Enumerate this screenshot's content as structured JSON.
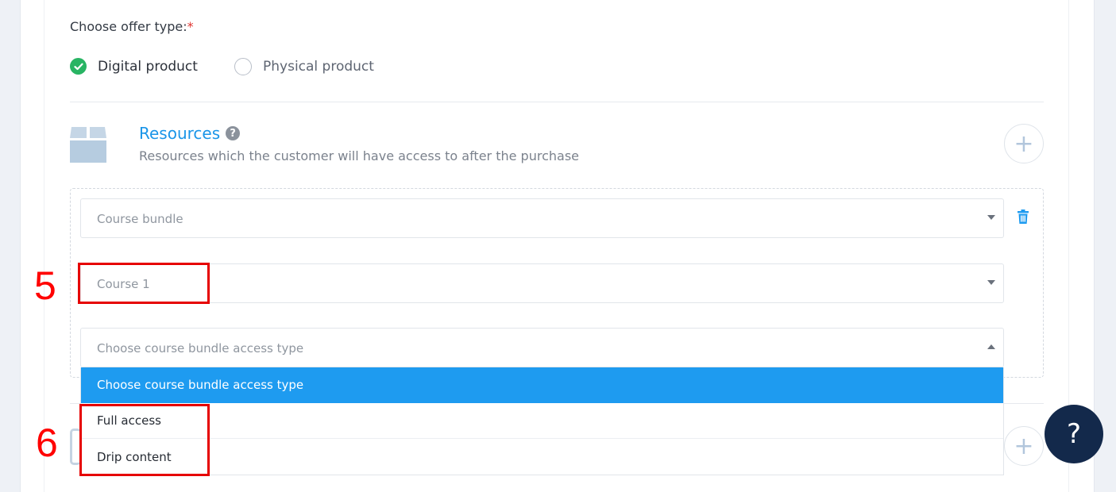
{
  "offer_type": {
    "label": "Choose offer type:",
    "required_mark": "*",
    "options": [
      {
        "label": "Digital product",
        "selected": true
      },
      {
        "label": "Physical product",
        "selected": false
      }
    ]
  },
  "resources": {
    "title": "Resources",
    "subtitle": "Resources which the customer will have access to after the purchase",
    "help_icon": "question-circle-icon",
    "add_icon": "plus-icon"
  },
  "resource_item": {
    "bundle_select": {
      "value": "Course bundle"
    },
    "course_select": {
      "value": "Course 1"
    },
    "access_select": {
      "value": "Choose course bundle access type",
      "open": true,
      "options": [
        "Choose course bundle access type",
        "Full access",
        "Drip content"
      ]
    },
    "delete_icon": "trash-icon"
  },
  "annotations": {
    "step5": "5",
    "step6": "6",
    "color": "#ff0000"
  },
  "help_button": {
    "label": "?"
  },
  "colors": {
    "accent": "#1e9bf0",
    "success": "#28b463",
    "fab": "#13294b"
  }
}
